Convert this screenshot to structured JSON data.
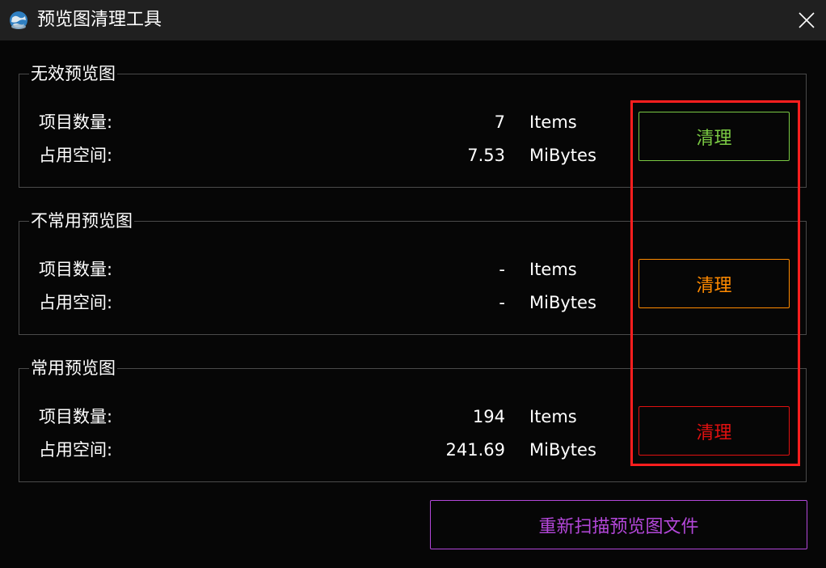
{
  "window": {
    "title": "预览图清理工具",
    "icon": "app-globe-icon",
    "close_icon": "close-icon"
  },
  "groups": [
    {
      "title": "无效预览图",
      "count_label": "项目数量:",
      "count_value": "7",
      "count_unit": "Items",
      "size_label": "占用空间:",
      "size_value": "7.53",
      "size_unit": "MiBytes",
      "button_label": "清理",
      "button_color": "#7ac943"
    },
    {
      "title": "不常用预览图",
      "count_label": "项目数量:",
      "count_value": "-",
      "count_unit": "Items",
      "size_label": "占用空间:",
      "size_value": "-",
      "size_unit": "MiBytes",
      "button_label": "清理",
      "button_color": "#ff8a00"
    },
    {
      "title": "常用预览图",
      "count_label": "项目数量:",
      "count_value": "194",
      "count_unit": "Items",
      "size_label": "占用空间:",
      "size_value": "241.69",
      "size_unit": "MiBytes",
      "button_label": "清理",
      "button_color": "#e01010"
    }
  ],
  "rescan": {
    "label": "重新扫描预览图文件",
    "color": "#b347d9"
  },
  "colors": {
    "background": "#060606",
    "titlebar": "#202020",
    "group_border": "#4a4a4a",
    "highlight": "#ff1e1e",
    "text": "#ffffff"
  }
}
